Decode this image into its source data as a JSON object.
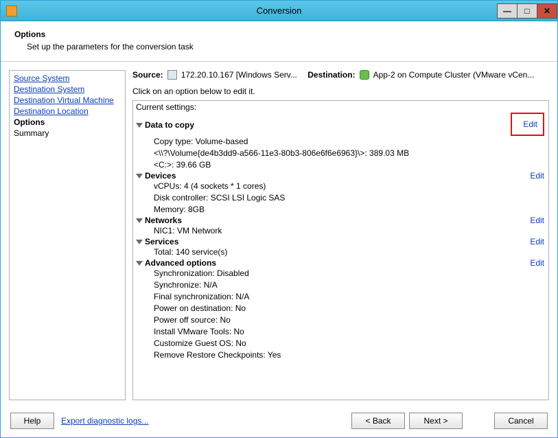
{
  "window": {
    "title": "Conversion"
  },
  "header": {
    "title": "Options",
    "subtitle": "Set up the parameters for the conversion task"
  },
  "sidebar": {
    "items": [
      {
        "label": "Source System",
        "type": "link"
      },
      {
        "label": "Destination System",
        "type": "link"
      },
      {
        "label": "Destination Virtual Machine",
        "type": "link"
      },
      {
        "label": "Destination Location",
        "type": "link"
      },
      {
        "label": "Options",
        "type": "current"
      },
      {
        "label": "Summary",
        "type": "plain"
      }
    ]
  },
  "srcdst": {
    "source_label": "Source:",
    "source_value": "172.20.10.167 [Windows Serv...",
    "dest_label": "Destination:",
    "dest_value": "App-2 on Compute Cluster (VMware vCen..."
  },
  "instruction": "Click on an option below to edit it.",
  "current_settings_label": "Current settings:",
  "edit_label": "Edit",
  "sections": {
    "data_to_copy": {
      "title": "Data to copy",
      "lines": [
        "Copy type: Volume-based",
        "<\\\\?\\Volume{de4b3dd9-a566-11e3-80b3-806e6f6e6963}\\>: 389.03 MB",
        "<C:>: 39.66 GB"
      ]
    },
    "devices": {
      "title": "Devices",
      "lines": [
        "vCPUs: 4 (4 sockets * 1 cores)",
        "Disk controller: SCSI LSI Logic SAS",
        "Memory: 8GB"
      ]
    },
    "networks": {
      "title": "Networks",
      "lines": [
        "NIC1: VM Network"
      ]
    },
    "services": {
      "title": "Services",
      "lines": [
        "Total: 140 service(s)"
      ]
    },
    "advanced": {
      "title": "Advanced options",
      "lines": [
        "Synchronization: Disabled",
        "Synchronize: N/A",
        "Final synchronization: N/A",
        "Power on destination: No",
        "Power off source: No",
        "Install VMware Tools: No",
        "Customize Guest OS: No",
        "Remove Restore Checkpoints: Yes"
      ]
    }
  },
  "footer": {
    "help": "Help",
    "export": "Export diagnostic logs...",
    "back": "< Back",
    "next": "Next >",
    "cancel": "Cancel"
  }
}
